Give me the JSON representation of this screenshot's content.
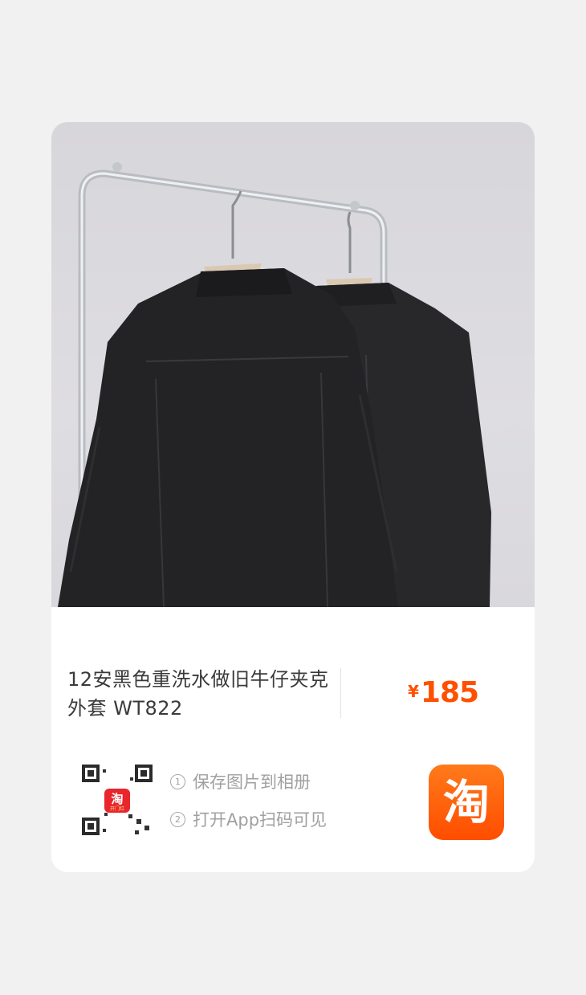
{
  "product": {
    "title": "12安黑色重洗水做旧牛仔夹克外套 WT822",
    "image_alt": "two black denim jackets hanging on a chrome rack",
    "currency": "¥",
    "price": "185"
  },
  "share": {
    "step1_num": "1",
    "step1": "保存图片到相册",
    "step2_num": "2",
    "step2": "打开App扫码可见",
    "qr_badge": "淘",
    "qr_badge_sub": "开门红"
  },
  "app_logo": {
    "label": "淘"
  },
  "colors": {
    "price": "#ff5000",
    "logo": "#ff5a00",
    "background": "#f1f1f1"
  },
  "icons": [
    "qr-code-icon",
    "taobao-logo-icon"
  ]
}
